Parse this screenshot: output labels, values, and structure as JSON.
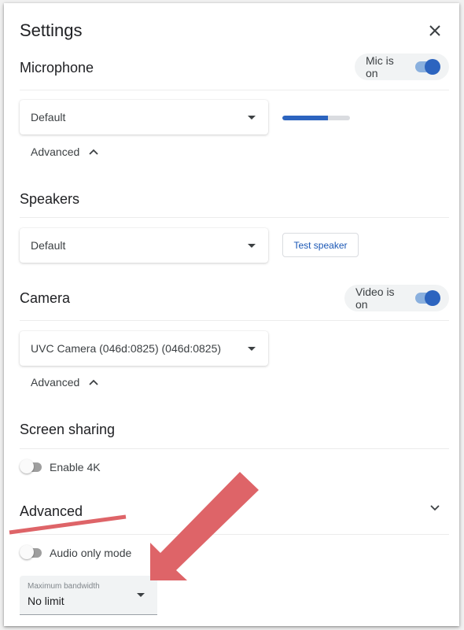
{
  "dialog": {
    "title": "Settings",
    "close_icon": "close-icon"
  },
  "microphone": {
    "title": "Microphone",
    "toggle_label": "Mic is on",
    "toggle_on": true,
    "device": "Default",
    "level_percent": 68,
    "advanced_label": "Advanced"
  },
  "speakers": {
    "title": "Speakers",
    "device": "Default",
    "test_button": "Test speaker"
  },
  "camera": {
    "title": "Camera",
    "toggle_label": "Video is on",
    "toggle_on": true,
    "device": "UVC Camera (046d:0825) (046d:0825)",
    "advanced_label": "Advanced"
  },
  "screen_sharing": {
    "title": "Screen sharing",
    "enable_4k_label": "Enable 4K",
    "enable_4k_on": false
  },
  "advanced": {
    "title": "Advanced",
    "audio_only_label": "Audio only mode",
    "audio_only_on": false,
    "bandwidth_label": "Maximum bandwidth",
    "bandwidth_value": "No limit"
  },
  "colors": {
    "accent": "#2c64bf",
    "annotation": "#de6468"
  }
}
